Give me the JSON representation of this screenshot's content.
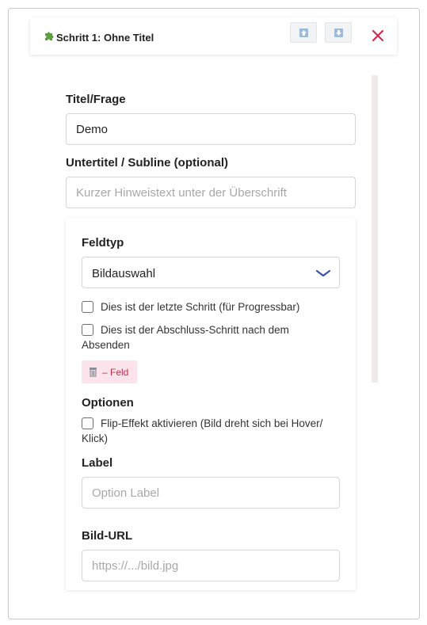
{
  "header": {
    "step_title": "Schritt 1: Ohne Titel",
    "move_up_icon": "arrow-up-icon",
    "move_down_icon": "arrow-down-icon",
    "close_icon": "close-icon",
    "puzzle_icon": "puzzle-icon"
  },
  "form": {
    "title_label": "Titel/Frage",
    "title_value": "Demo",
    "subtitle_label": "Untertitel / Subline (optional)",
    "subtitle_placeholder": "Kurzer Hinweistext unter der Überschrift"
  },
  "field": {
    "type_label": "Feldtyp",
    "type_value": "Bildauswahl",
    "last_step_label": "Dies ist der letzte Schritt (für Progressbar)",
    "final_step_label": "Dies ist der Abschluss-Schritt nach dem Absenden",
    "remove_label": "– Feld",
    "options_label": "Optionen",
    "flip_label": "Flip-Effekt aktivieren (Bild dreht sich bei Hover/ Klick)",
    "option_label_label": "Label",
    "option_label_placeholder": "Option Label",
    "image_url_label": "Bild-URL",
    "image_url_placeholder": "https://.../bild.jpg"
  },
  "colors": {
    "accent_close": "#d4204a",
    "remove_bg": "#fde4ec",
    "remove_text": "#c0304d",
    "chevron": "#3b4fa8",
    "puzzle": "#5aa03c"
  }
}
